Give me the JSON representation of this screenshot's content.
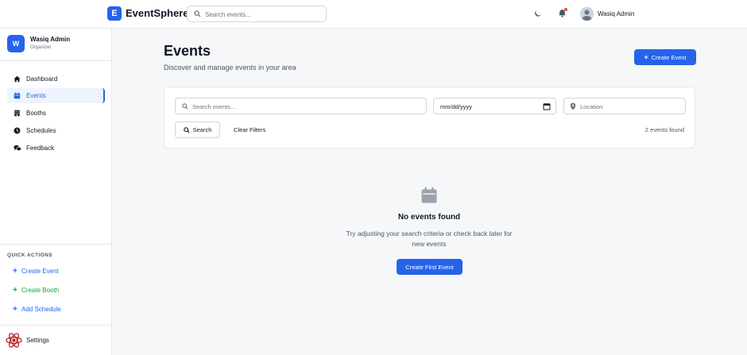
{
  "app": {
    "logo_letter": "E",
    "name": "EventSphere",
    "search_placeholder": "Search events...",
    "user_name": "Wasiq Admin"
  },
  "sidebar": {
    "avatar_letter": "W",
    "user_name": "Wasiq Admin",
    "user_role": "Organizer",
    "nav": [
      {
        "label": "Dashboard",
        "icon": "home-icon"
      },
      {
        "label": "Events",
        "icon": "calendar-icon",
        "active": true
      },
      {
        "label": "Booths",
        "icon": "building-icon"
      },
      {
        "label": "Schedules",
        "icon": "clock-icon"
      },
      {
        "label": "Feedback",
        "icon": "chat-icon"
      }
    ],
    "quick_actions_title": "QUICK ACTIONS",
    "quick_actions": [
      {
        "label": "Create Event",
        "color": "#2563eb"
      },
      {
        "label": "Create Booth",
        "color": "#16a34a"
      },
      {
        "label": "Add Schedule",
        "color": "#2563eb"
      }
    ],
    "settings_label": "Settings"
  },
  "main": {
    "title": "Events",
    "subtitle": "Discover and manage events in your area",
    "create_button": "Create Event",
    "filters": {
      "search_placeholder": "Search events...",
      "date_placeholder": "mm/dd/yyyy",
      "location_placeholder": "Location",
      "search_button": "Search",
      "clear_button": "Clear Filters",
      "count_text": "2 events found"
    },
    "empty": {
      "title": "No events found",
      "description": "Try adjusting your search criteria or check back later for new events",
      "button": "Create First Event"
    }
  },
  "colors": {
    "accent": "#2563eb",
    "success": "#16a34a",
    "notification": "#ef4444"
  }
}
